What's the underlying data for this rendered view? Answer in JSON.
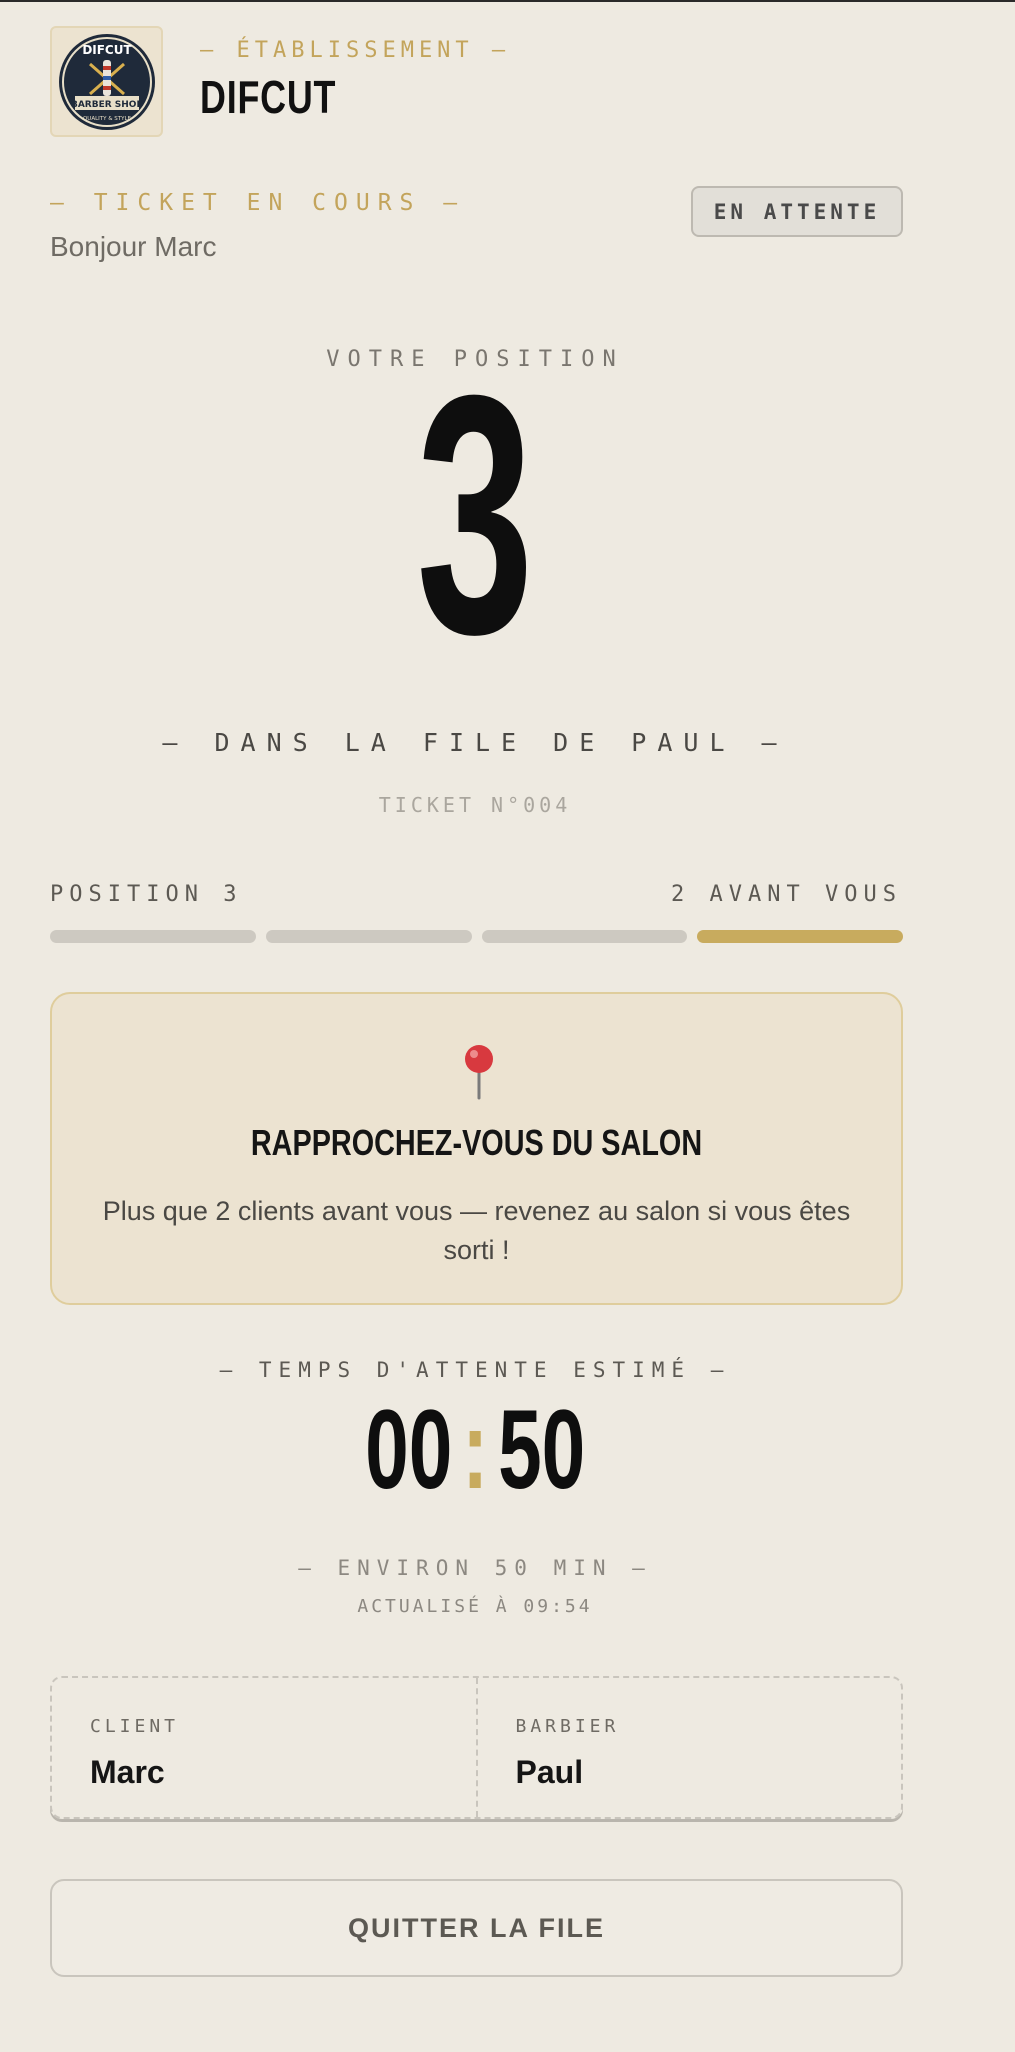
{
  "header": {
    "establishment_label": "— ÉTABLISSEMENT —",
    "establishment_name": "DIFCUT",
    "logo": {
      "icon": "barber-logo-icon",
      "text_top": "DIFCUT",
      "text_band": "BARBER SHOP",
      "text_bottom": "QUALITY & STYLE"
    }
  },
  "ticket": {
    "label": "— TICKET EN COURS —",
    "greeting": "Bonjour Marc",
    "status": "EN ATTENTE",
    "number_label": "TICKET N°004"
  },
  "position": {
    "label": "VOTRE POSITION",
    "value": "3",
    "queue_label": "— DANS LA FILE DE PAUL —",
    "progress_left": "POSITION 3",
    "progress_right": "2 AVANT VOUS",
    "progress_segments": 4,
    "progress_active_segments": 1
  },
  "alert": {
    "icon": "map-pin-icon",
    "title": "RAPPROCHEZ-VOUS DU SALON",
    "text": "Plus que 2 clients avant vous — revenez au salon si vous êtes sorti !"
  },
  "wait": {
    "label": "— TEMPS D'ATTENTE ESTIMÉ —",
    "hours": "00",
    "separator": ":",
    "minutes": "50",
    "approx": "— ENVIRON 50 MIN —",
    "updated": "ACTUALISÉ À 09:54"
  },
  "info": {
    "client_label": "CLIENT",
    "client_value": "Marc",
    "barber_label": "BARBIER",
    "barber_value": "Paul"
  },
  "actions": {
    "quit_label": "QUITTER LA FILE"
  },
  "colors": {
    "background": "#eeeae1",
    "accent_gold": "#c8ab5e",
    "text_dark": "#0e0e0e"
  }
}
